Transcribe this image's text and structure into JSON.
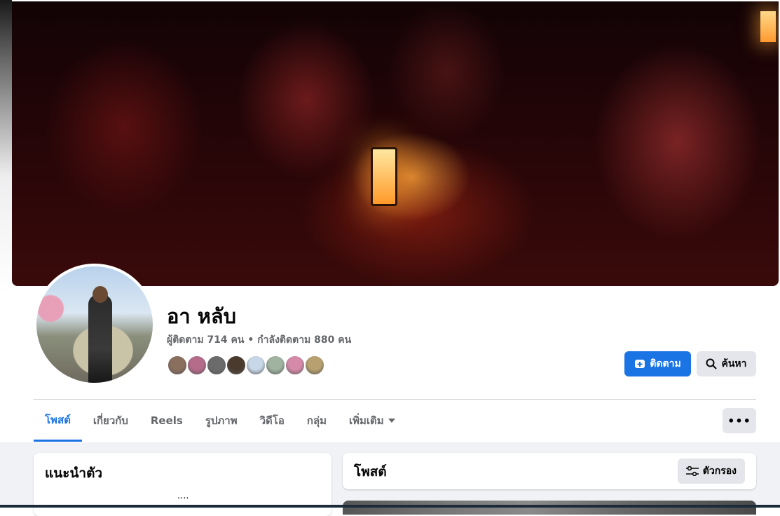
{
  "profile": {
    "name": "อา หลับ",
    "stats": "ผู้ติดตาม 714 คน • กำลังติดตาม 880 คน"
  },
  "friend_faces": [
    {
      "color": "#8a6f5e"
    },
    {
      "color": "#b56b8a"
    },
    {
      "color": "#6b6b6b"
    },
    {
      "color": "#4a3a2e"
    },
    {
      "color": "#c8d8e8"
    },
    {
      "color": "#9fb3a0"
    },
    {
      "color": "#d48aa8"
    },
    {
      "color": "#b8a070"
    }
  ],
  "actions": {
    "follow_label": "ติดตาม",
    "search_label": "ค้นหา"
  },
  "tabs": [
    {
      "label": "โพสต์",
      "active": true
    },
    {
      "label": "เกี่ยวกับ"
    },
    {
      "label": "Reels"
    },
    {
      "label": "รูปภาพ"
    },
    {
      "label": "วิดีโอ"
    },
    {
      "label": "กลุ่ม"
    },
    {
      "label": "เพิ่มเติม",
      "dropdown": true
    }
  ],
  "more_button": "•••",
  "intro": {
    "title": "แนะนำตัว",
    "ellipsis": "...."
  },
  "posts": {
    "title": "โพสต์",
    "filter_label": "ตัวกรอง"
  },
  "colors": {
    "accent": "#1b74e4",
    "secondary_button": "#e4e6eb",
    "page_bg": "#f0f2f5"
  }
}
